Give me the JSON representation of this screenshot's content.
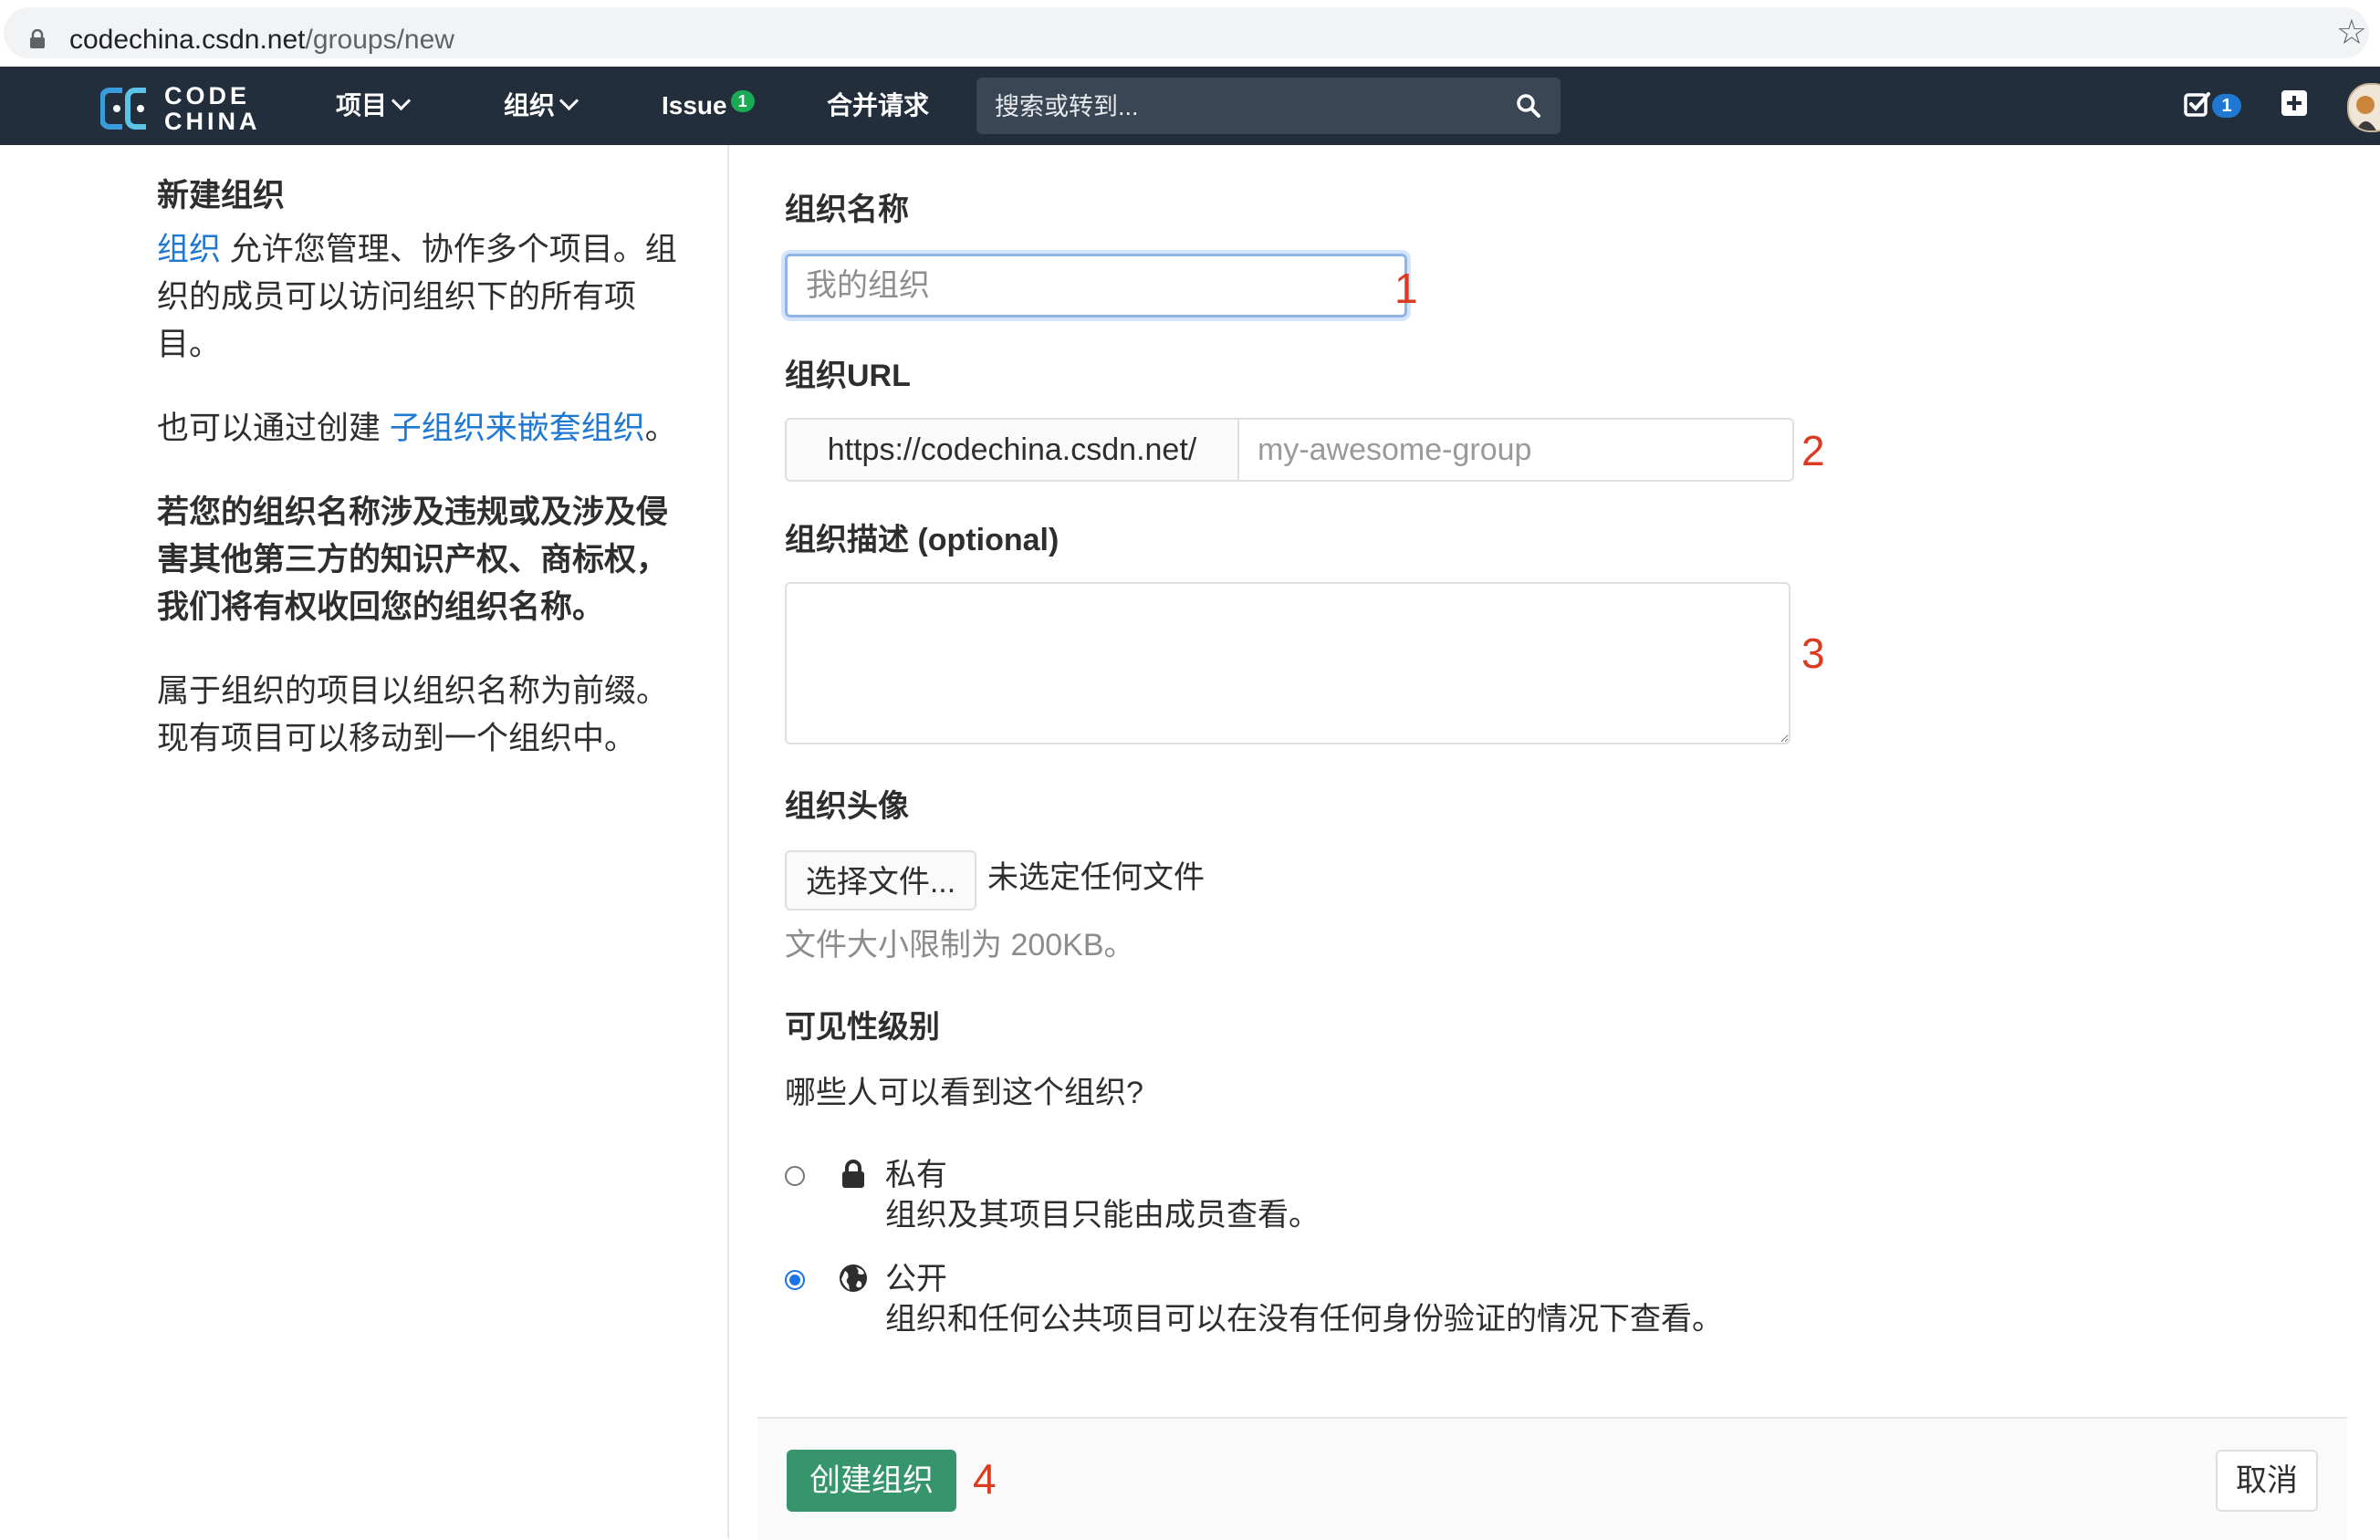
{
  "browser": {
    "url_domain": "codechina.csdn.net",
    "url_path": "/groups/new"
  },
  "navbar": {
    "logo_line1": "CODE",
    "logo_line2": "CHINA",
    "items": [
      {
        "label": "项目",
        "dropdown": true
      },
      {
        "label": "组织",
        "dropdown": true
      },
      {
        "label": "Issue",
        "badge": "1"
      },
      {
        "label": "合并请求"
      }
    ],
    "search_placeholder": "搜索或转到...",
    "todo_count": "1"
  },
  "sidebar": {
    "heading": "新建组织",
    "p1_link": "组织",
    "p1_text": " 允许您管理、协作多个项目。组织的成员可以访问组织下的所有项目。",
    "p2_text": "也可以通过创建 ",
    "p2_link": "子组织来嵌套组织",
    "p2_end": "。",
    "p3_bold": "若您的组织名称涉及违规或及涉及侵害其他第三方的知识产权、商标权，我们将有权收回您的组织名称。",
    "p4_text": "属于组织的项目以组织名称为前缀。现有项目可以移动到一个组织中。"
  },
  "form": {
    "name_label": "组织名称",
    "name_placeholder": "我的组织",
    "url_label": "组织URL",
    "url_prefix": "https://codechina.csdn.net/",
    "url_placeholder": "my-awesome-group",
    "desc_label": "组织描述 (optional)",
    "avatar_label": "组织头像",
    "file_button": "选择文件...",
    "file_status": "未选定任何文件",
    "file_hint": "文件大小限制为 200KB。",
    "visibility_label": "可见性级别",
    "visibility_question": "哪些人可以看到这个组织?",
    "options": [
      {
        "title": "私有",
        "desc": "组织及其项目只能由成员查看。",
        "checked": false,
        "icon": "lock-icon"
      },
      {
        "title": "公开",
        "desc": "组织和任何公共项目可以在没有任何身份验证的情况下查看。",
        "checked": true,
        "icon": "globe-icon"
      }
    ],
    "annotations": [
      "1",
      "2",
      "3",
      "4"
    ],
    "create_button": "创建组织",
    "cancel_button": "取消"
  },
  "colors": {
    "navbar_bg": "#222e3c",
    "link": "#1f78d1",
    "create_button": "#37956e",
    "annotation_red": "#db3b21"
  }
}
